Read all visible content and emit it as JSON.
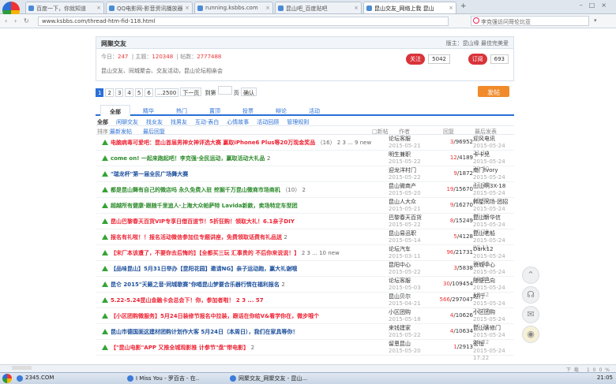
{
  "browser": {
    "tabs": [
      {
        "label": "百度一下，你就知道"
      },
      {
        "label": "QQ电影网-影音资讯播放器"
      },
      {
        "label": "running.ksbbs.com"
      },
      {
        "label": "昆山吧_百度贴吧"
      },
      {
        "label": "昆山交友_网络上我 昆山"
      }
    ],
    "new_tab": "+",
    "url": "www.ksbbs.com/thread-htm-fid-118.html",
    "search_placeholder": "李克强访问哥伦比亚",
    "nav_back": "‹",
    "nav_forward": "›",
    "nav_refresh": "↻"
  },
  "forum": {
    "title": "网聚交友",
    "moderators": "版主：昆山缘 最佳完美爱",
    "stats_prefix": "今日：",
    "today": "247",
    "topics_label": "主题：",
    "topics": "120348",
    "posts_label": "帖数：",
    "posts": "2777488",
    "description": "昆山交友、同城聚会、交友活动，昆山论坛相亲会",
    "follow_label": "关注",
    "follow_count": "5042",
    "rss_label": "订阅",
    "rss_count": "693"
  },
  "pager": {
    "pages": [
      "1",
      "2",
      "3",
      "4",
      "5",
      "6",
      "...2500"
    ],
    "next": "下一页",
    "goto_label": "到第",
    "goto_unit": "页",
    "confirm": "确认",
    "post_button": "发帖"
  },
  "filter_tabs": [
    "全部",
    "精华",
    "热门",
    "置顶",
    "投票",
    "辩论",
    "活动"
  ],
  "subtabs": [
    "全部",
    "闲聊交友",
    "找女友",
    "找男友",
    "互动·表白",
    "心情故事",
    "活动回顾",
    "管理规则"
  ],
  "columns": {
    "sort_label": "排序：",
    "sort_latest": "最新发帖",
    "sort_reply": "最后回复",
    "new_threads": "□新帖",
    "author": "作者",
    "replies": "回复",
    "last_post": "最后发表"
  },
  "threads": [
    {
      "title": "电脑病毒可爱吧：昆山首届男神女神评选大赛 赢取iPhone6 Plus等20万现金奖品",
      "pages": "（16） 2 3 ... 9 new",
      "color": "red",
      "author": "论坛客服",
      "author_date": "2015-05-21",
      "replies": "3",
      "views": "/96952",
      "last": "迎风电讯",
      "last_date": "2015-05-24 21:14"
    },
    {
      "title": "come on! 一起来跑起吧！李克强·全民运动，赢取活动大礼品",
      "pages": "2",
      "color": "green",
      "author": "明生兼职",
      "author_date": "2015-05-22",
      "replies": "12",
      "views": "/4189",
      "last": "卡卡兒",
      "last_date": "2015-05-24 20:30"
    },
    {
      "title": "\"瑞龙杯\"第一届全民广场舞大赛",
      "pages": "",
      "color": "blue",
      "author": "迎龙洋村门",
      "author_date": "2015-05-22",
      "replies": "9",
      "views": "/1872",
      "last": "南门Ivory",
      "last_date": "2015-05-24 17:08"
    },
    {
      "title": "都是昆山舞有自己的微店吗 永久免费入驻 挖掘千万昆山微商市场商机",
      "pages": "（10） 2",
      "color": "green",
      "author": "昆山微商产",
      "author_date": "2015-05-20",
      "replies": "19",
      "views": "/15670",
      "last": "山山啊3X-18",
      "last_date": "2015-05-24 19:00"
    },
    {
      "title": "超越所有健康·跟随千里追人·上海大众帕萨特 Lavida新款，卖场特定车型团",
      "pages": "",
      "color": "green",
      "author": "昆山人大众",
      "author_date": "2015-05-21",
      "replies": "9",
      "views": "/16270",
      "last": "韩星同场·团招",
      "last_date": "2015-05-24 09:40"
    },
    {
      "title": "昆山巴黎春天百货VIP专享日借百道节！5折狂购！领取大礼！6.1亲子DIY",
      "pages": "",
      "color": "red",
      "author": "巴黎春天百货",
      "author_date": "2015-05-22",
      "replies": "8",
      "views": "/15249",
      "last": "昆山新华信",
      "last_date": "2015-05-24 00:21"
    },
    {
      "title": "报名有礼啦！！报名活动微信参加位专题讲座，免费领取话费有礼品送",
      "pages": "2",
      "color": "red",
      "author": "昆山易迅职",
      "author_date": "2015-05-14",
      "replies": "5",
      "views": "/4128",
      "last": "昆山老船",
      "last_date": "2015-05-24 09:11"
    },
    {
      "title": "【宋厂本该遭了，不要你去后悔的】【全都买三玩 汇事贵的 不后你来说说！】",
      "pages": "2 3 ... 10 new",
      "color": "red",
      "author": "论坛汽车",
      "author_date": "2015-03-11",
      "replies": "96",
      "views": "/21731",
      "last": "Dark12",
      "last_date": "2015-05-24 21:33"
    },
    {
      "title": "【品味昆山】5月31日举办【昆阳花园】邀请NG】亲子运动跑，赢大礼谢哦",
      "pages": "",
      "color": "blue",
      "author": "昆阳中心",
      "author_date": "2015-05-22",
      "replies": "3",
      "views": "/5838",
      "last": "浪城中心",
      "last_date": "2015-05-24 18:22"
    },
    {
      "title": "昆仑 2015\"天籁之音·同城歌赛\"你唱昆山梦要合乐器行情在福利报名",
      "pages": "2",
      "color": "blue",
      "author": "论坛客服",
      "author_date": "2015-05-03",
      "replies": "30",
      "views": "/109454",
      "last": "随便巴向",
      "last_date": "2015-05-24 17:42"
    },
    {
      "title": "5.22-5.24昆山金融卡会总会下！你，参加者啦！ 2 3 ... 57",
      "pages": "",
      "color": "red",
      "author": "昆山贝尔",
      "author_date": "2015-04-21",
      "replies": "566",
      "views": "/297047",
      "last": "越行",
      "last_date": "2015-05-24 23:07"
    },
    {
      "title": "【小区团购微服务】5月24日装修节报名中拉装，跟话在你给V&看学你在，微步哦个",
      "pages": "",
      "color": "red",
      "author": "小区团购",
      "author_date": "2015-05-18",
      "replies": "4",
      "views": "/10626",
      "last": "小区团购",
      "last_date": "2015-05-24 09:32"
    },
    {
      "title": "昆山市德国面这建材团购计划作大客 5月24日（本周日），我们在家具等你！",
      "pages": "",
      "color": "blue",
      "author": "来钱建家",
      "author_date": "2015-05-22",
      "replies": "4",
      "views": "/10634",
      "last": "昆山装修门",
      "last_date": "2015-05-24 20:32"
    },
    {
      "title": "【\"昆山电影\"APP 又推全城观影推 计参节\"盘\"带电影】",
      "pages": "2",
      "color": "red",
      "author": "留恩昆山",
      "author_date": "2015-05-20",
      "replies": "1",
      "views": "/2913",
      "last": "密恒",
      "last_date": "2015-05-24 17:22"
    }
  ],
  "sidebar_icons": [
    "back-to-top-icon",
    "headset-icon",
    "wechat-icon",
    "weibo-icon"
  ],
  "status_bar": {
    "downloads": "下载",
    "zoom": "100%"
  },
  "taskbar": {
    "items": [
      "2345.COM",
      "I Miss You - 罗百吉 - 在..",
      "网聚交友_网聚交友 - 昆山..."
    ],
    "clock": "21:05"
  }
}
